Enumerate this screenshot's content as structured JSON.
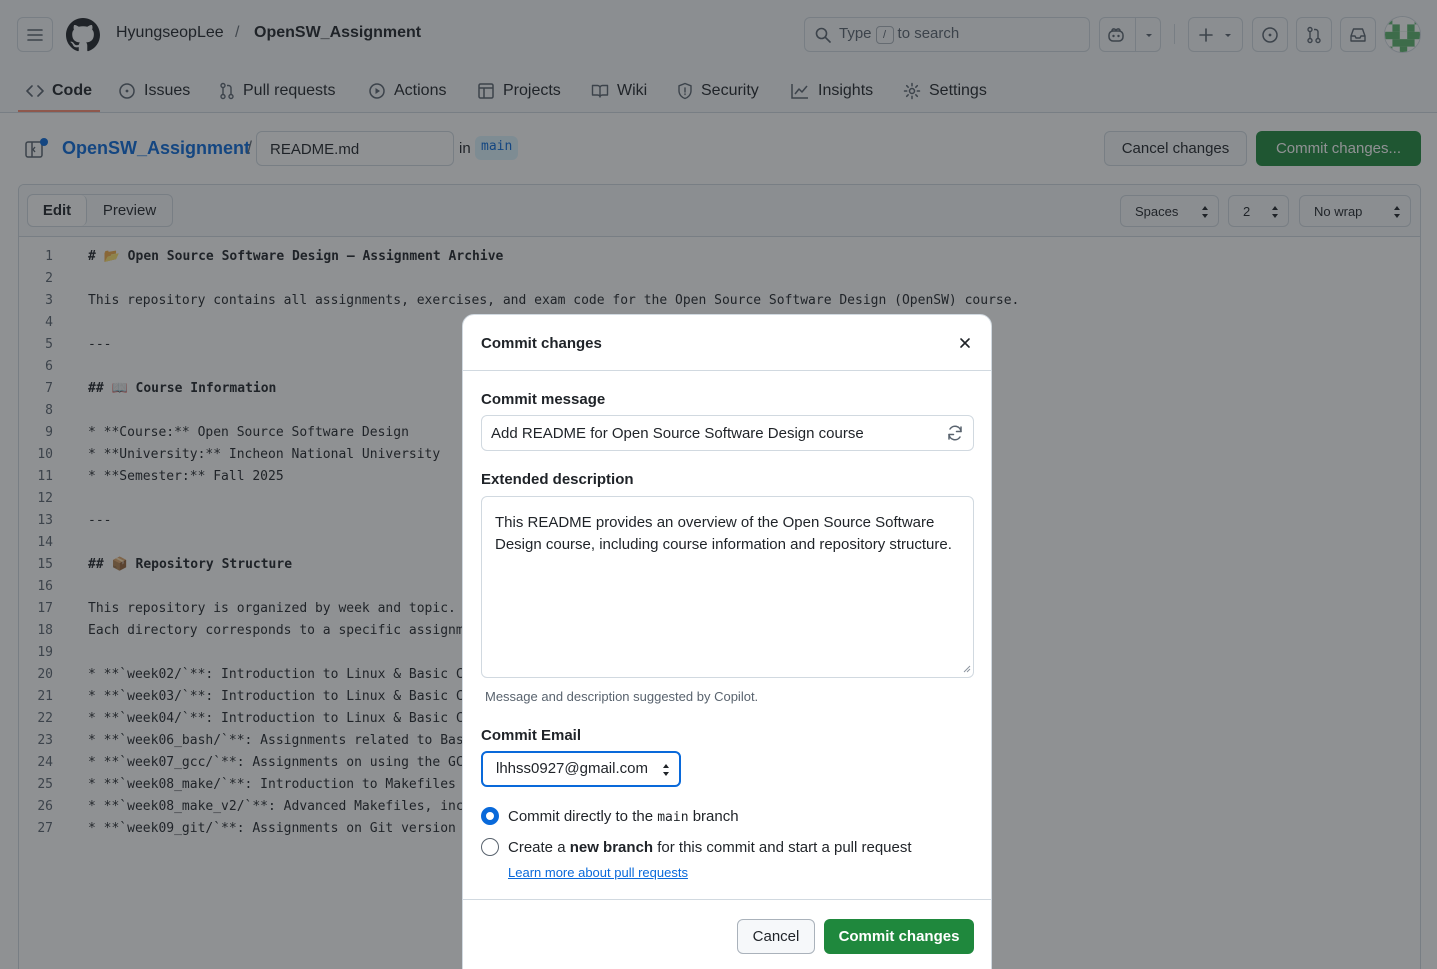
{
  "header": {
    "owner": "HyungseopLee",
    "separator": "/",
    "repo": "OpenSW_Assignment",
    "search_prefix": "Type",
    "search_key": "/",
    "search_suffix": "to search"
  },
  "tabs": [
    {
      "label": "Code",
      "icon": "code-icon"
    },
    {
      "label": "Issues",
      "icon": "issue-icon"
    },
    {
      "label": "Pull requests",
      "icon": "pull-request-icon"
    },
    {
      "label": "Actions",
      "icon": "play-icon"
    },
    {
      "label": "Projects",
      "icon": "table-icon"
    },
    {
      "label": "Wiki",
      "icon": "book-icon"
    },
    {
      "label": "Security",
      "icon": "shield-icon"
    },
    {
      "label": "Insights",
      "icon": "graph-icon"
    },
    {
      "label": "Settings",
      "icon": "gear-icon"
    }
  ],
  "file": {
    "repo": "OpenSW_Assignment",
    "slash": "/",
    "filename": "README.md",
    "in": "in",
    "branch": "main",
    "cancel": "Cancel changes",
    "commit": "Commit changes..."
  },
  "editor": {
    "edit": "Edit",
    "preview": "Preview",
    "indent_mode": "Spaces",
    "indent_size": "2",
    "wrap_mode": "No wrap",
    "lines": [
      "# 📂 Open Source Software Design – Assignment Archive",
      "",
      "This repository contains all assignments, exercises, and exam code for the Open Source Software Design (OpenSW) course.",
      "",
      "---",
      "",
      "## 📖 Course Information",
      "",
      "* **Course:** Open Source Software Design",
      "* **University:** Incheon National University",
      "* **Semester:** Fall 2025",
      "",
      "---",
      "",
      "## 📦 Repository Structure",
      "",
      "This repository is organized by week and topic.",
      "Each directory corresponds to a specific assignm",
      "",
      "* **`week02/`**: Introduction to Linux & Basic C",
      "* **`week03/`**: Introduction to Linux & Basic C",
      "* **`week04/`**: Introduction to Linux & Basic C",
      "* **`week06_bash/`**: Assignments related to Bas",
      "* **`week07_gcc/`**: Assignments on using the GC",
      "* **`week08_make/`**: Introduction to Makefiles",
      "* **`week08_make_v2/`**: Advanced Makefiles, inc",
      "* **`week09_git/`**: Assignments on Git version"
    ]
  },
  "dialog": {
    "title": "Commit changes",
    "message_label": "Commit message",
    "message_value": "Add README for Open Source Software Design course",
    "desc_label": "Extended description",
    "desc_value": "This README provides an overview of the Open Source Software Design course, including course information and repository structure.",
    "hint": "Message and description suggested by Copilot.",
    "email_label": "Commit Email",
    "email_value": "lhhss0927@gmail.com",
    "opt1_pre": "Commit directly to the",
    "opt1_branch": "main",
    "opt1_post": "branch",
    "opt2_pre": "Create a",
    "opt2_bold": "new branch",
    "opt2_post": "for this commit and start a pull request",
    "learn_more": "Learn more about pull requests",
    "cancel": "Cancel",
    "commit": "Commit changes"
  },
  "colors": {
    "primary_green": "#1f883d",
    "link_blue": "#0969da",
    "active_tab_underline": "#fd8c73"
  }
}
